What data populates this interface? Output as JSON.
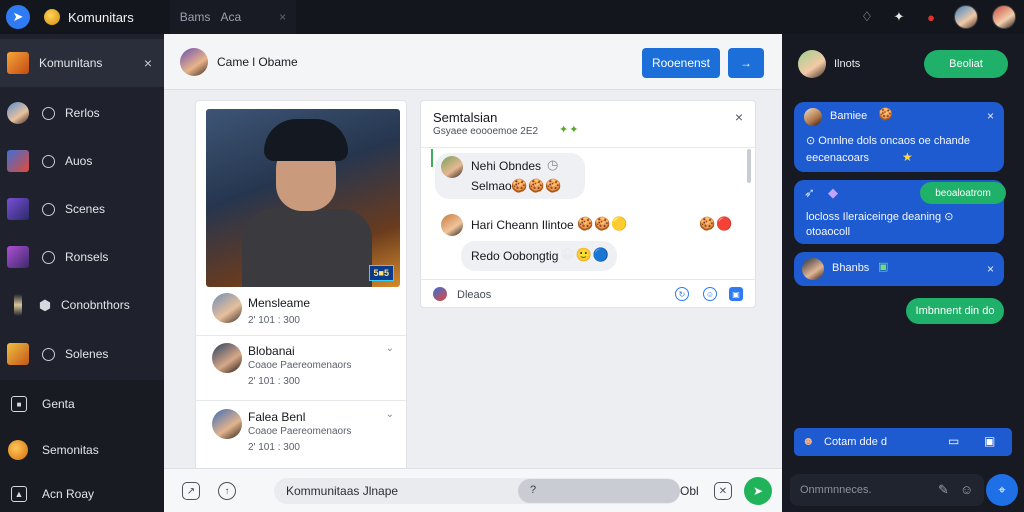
{
  "topbar": {
    "app_title": "Komunitars",
    "tab_1": "Bams",
    "tab_2": "Aca",
    "close_glyph": "×"
  },
  "sidebar": {
    "items": [
      {
        "label": "Komunitans",
        "icon": "thumbnail"
      },
      {
        "label": "Rerlos",
        "icon": "thumbnail"
      },
      {
        "label": "Auos",
        "icon": "thumbnail"
      },
      {
        "label": "Scenes",
        "icon": "thumbnail"
      },
      {
        "label": "Ronsels",
        "icon": "thumbnail"
      },
      {
        "label": "Conobnthors",
        "icon": "thumbnail"
      },
      {
        "label": "Solenes",
        "icon": "thumbnail"
      },
      {
        "label": "Genta",
        "icon": "square-icon"
      },
      {
        "label": "Semonitas",
        "icon": "coin-icon"
      },
      {
        "label": "Acn Roay",
        "icon": "image-icon"
      }
    ],
    "close_glyph": "×"
  },
  "center": {
    "header_title": "Came l Obame",
    "primary_button": "Rooenenst",
    "arrow_button": "→",
    "hero_badge": "5■5",
    "entries": [
      {
        "name": "Mensleame",
        "sub1": "2' 101 : 300",
        "sub2": ""
      },
      {
        "name": "Blobanai",
        "sub1": "Coaoe Paereomenaors",
        "sub2": "2' 101 : 300"
      },
      {
        "name": "Falea Benl",
        "sub1": "Coaoe Paereomenaors",
        "sub2": "2' 101 : 300"
      }
    ],
    "panel": {
      "title": "Semtalsian",
      "subtitle": "Gsyaee eoooemoe 2E2",
      "messages": [
        {
          "name": "Nehi Obndes",
          "text": "Selmao"
        },
        {
          "name": "Hari Cheann Ilintoe",
          "text": "Redo Oobongtig"
        }
      ],
      "footer_label": "Dleaos"
    },
    "footer": {
      "input_text": "Kommunitaas Jlnape",
      "pill_text": "?",
      "trailing": "Obl"
    }
  },
  "right": {
    "header_name": "Ilnots",
    "header_button": "Beoliat",
    "cards": [
      {
        "title": "Bamiee",
        "line1": "⊙ Onnlne dols oncaos oe chande",
        "line2": "eecenacoars"
      },
      {
        "pill": "beoaloatrom",
        "line1": "locloss Ileraiceinge deaning ⊙",
        "line2": "otoaocoll"
      },
      {
        "title": "Bhanbs"
      }
    ],
    "green_pill": "Imbnnent din do",
    "bar_text": "Cotam dde d",
    "input_placeholder": "Onmmnneces."
  }
}
